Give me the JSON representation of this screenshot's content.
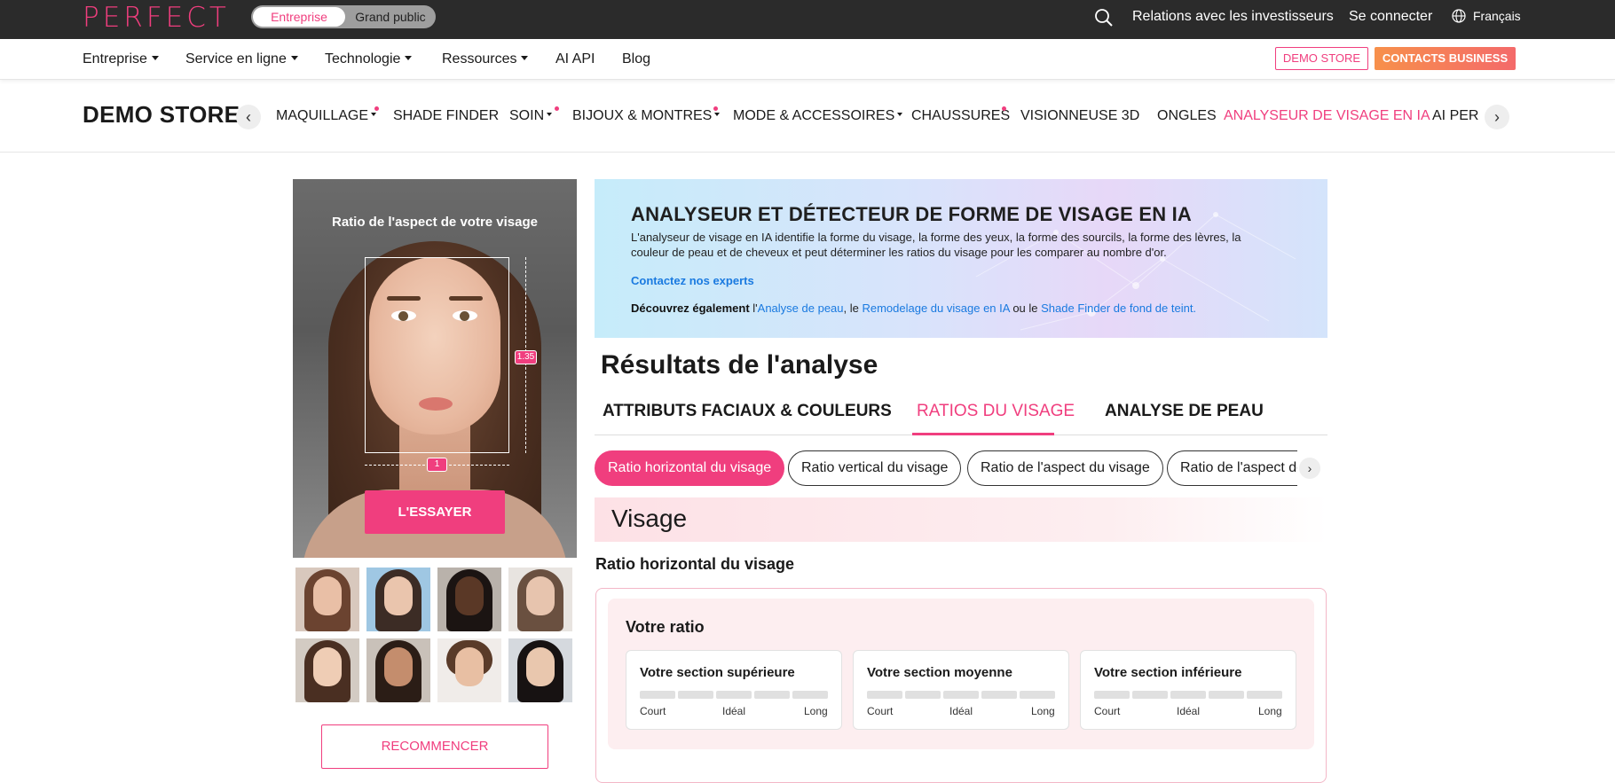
{
  "topbar": {
    "logo": "PERFECT",
    "toggle": {
      "selected": "Entreprise",
      "other": "Grand public"
    },
    "links": [
      "Relations avec les investisseurs",
      "Se connecter"
    ],
    "language": "Français",
    "icons": [
      "search-icon",
      "globe-icon"
    ]
  },
  "mainnav": {
    "items": [
      {
        "label": "Entreprise",
        "dropdown": true
      },
      {
        "label": "Service en ligne",
        "dropdown": true
      },
      {
        "label": "Technologie",
        "dropdown": true
      },
      {
        "label": "Ressources",
        "dropdown": true
      },
      {
        "label": "AI API",
        "dropdown": false
      },
      {
        "label": "Blog",
        "dropdown": false
      }
    ],
    "demo_store_button": "DEMO STORE",
    "contacts_button": "CONTACTS BUSINESS"
  },
  "demonav": {
    "title": "DEMO STORE",
    "categories": [
      {
        "label": "MAQUILLAGE",
        "dropdown": true,
        "dot": true
      },
      {
        "label": "SHADE FINDER",
        "dropdown": false,
        "dot": false
      },
      {
        "label": "SOIN",
        "dropdown": true,
        "dot": true
      },
      {
        "label": "BIJOUX & MONTRES",
        "dropdown": true,
        "dot": true
      },
      {
        "label": "MODE & ACCESSOIRES",
        "dropdown": true,
        "dot": false
      },
      {
        "label": "CHAUSSURES",
        "dropdown": false,
        "dot": true
      },
      {
        "label": "VISIONNEUSE 3D",
        "dropdown": false,
        "dot": false
      },
      {
        "label": "ONGLES",
        "dropdown": false,
        "dot": false
      },
      {
        "label": "ANALYSEUR DE VISAGE EN IA",
        "dropdown": false,
        "dot": false,
        "active": true
      },
      {
        "label": "AI PER",
        "dropdown": false,
        "dot": false
      }
    ]
  },
  "left": {
    "title": "Ratio de l'aspect de votre visage",
    "ratio_vertical": "1.35",
    "ratio_horizontal": "1",
    "try_button": "L'ESSAYER",
    "restart_button": "RECOMMENCER"
  },
  "hero": {
    "title": "ANALYSEUR ET DÉTECTEUR DE FORME DE VISAGE EN IA",
    "description": "L'analyseur de visage en IA identifie la forme du visage, la forme des yeux, la forme des sourcils, la forme des lèvres, la couleur de peau et de cheveux et peut déterminer les ratios du visage pour les comparer au nombre d'or.",
    "contact_link": "Contactez nos experts",
    "also_prefix": "Découvrez également",
    "also_l": " l'",
    "link_skin": "Analyse de peau",
    "also_sep1": ", le ",
    "link_reshape": "Remodelage du visage en IA",
    "also_sep2": " ou le ",
    "link_shade": "Shade Finder de fond de teint."
  },
  "results": {
    "title": "Résultats de l'analyse",
    "tabs": [
      {
        "label": "ATTRIBUTS FACIAUX & COULEURS",
        "active": false
      },
      {
        "label": "RATIOS DU VISAGE",
        "active": true
      },
      {
        "label": "ANALYSE DE PEAU",
        "active": false
      }
    ],
    "chips": [
      {
        "label": "Ratio horizontal du visage",
        "active": true
      },
      {
        "label": "Ratio vertical du visage",
        "active": false
      },
      {
        "label": "Ratio de l'aspect du visage",
        "active": false
      },
      {
        "label": "Ratio de l'aspect des yeux",
        "active": false
      }
    ],
    "section": "Visage",
    "subtitle": "Ratio horizontal du visage",
    "card": {
      "heading": "Votre ratio",
      "segments": [
        {
          "title": "Votre section supérieure",
          "low": "Court",
          "mid": "Idéal",
          "high": "Long"
        },
        {
          "title": "Votre section moyenne",
          "low": "Court",
          "mid": "Idéal",
          "high": "Long"
        },
        {
          "title": "Votre section inférieure",
          "low": "Court",
          "mid": "Idéal",
          "high": "Long"
        }
      ]
    }
  },
  "colors": {
    "brand_pink": "#f03e7e",
    "topbar_bg": "#2b2b2b",
    "contacts_gradient": [
      "#f7904b",
      "#f46a6a"
    ],
    "link_blue": "#1a7ae0"
  }
}
